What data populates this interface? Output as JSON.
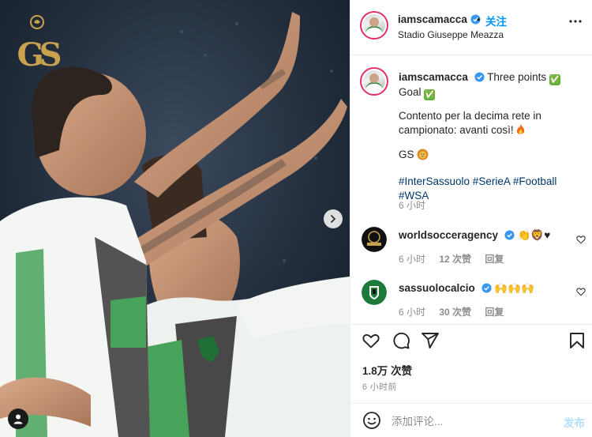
{
  "post": {
    "media": {
      "watermark_icon": "gs-crest-logo",
      "next_icon": "chevron-right-icon",
      "tag_icon": "user-tag-icon"
    },
    "header": {
      "username": "iamscamacca",
      "separator": "•",
      "follow_label": "关注",
      "location": "Stadio Giuseppe Meazza",
      "more_icon": "more-options-icon"
    },
    "caption": {
      "username": "iamscamacca",
      "line1": "Three points",
      "line1_emoji": "✅",
      "line2": "Goal",
      "line2_emoji": "✅",
      "paragraph": "Contento per la decima rete in campionato: avanti così!",
      "signature": "GS",
      "hashtags": "#InterSassuolo #SerieA #Football #WSA",
      "time": "6 小时"
    },
    "comments": [
      {
        "username": "worldsocceragency",
        "text": "👏🦁♥",
        "time": "6 小时",
        "likes": "12 次赞",
        "reply": "回复"
      },
      {
        "username": "sassuolocalcio",
        "text": "🙌🙌🙌",
        "time": "6 小时",
        "likes": "30 次赞",
        "reply": "回复"
      }
    ],
    "actions": {
      "like_icon": "heart-icon",
      "comment_icon": "comment-icon",
      "share_icon": "share-icon",
      "save_icon": "bookmark-icon"
    },
    "likes_count": "1.8万 次赞",
    "posted_ago": "6 小时前",
    "add_comment": {
      "placeholder": "添加评论...",
      "post_label": "发布",
      "emoji_icon": "smiley-icon"
    },
    "colors": {
      "accent_blue": "#0095f6",
      "hashtag": "#00376b",
      "muted": "#8e8e8e",
      "verified": "#3897f0",
      "watermark_gold": "#c9a24f"
    }
  }
}
